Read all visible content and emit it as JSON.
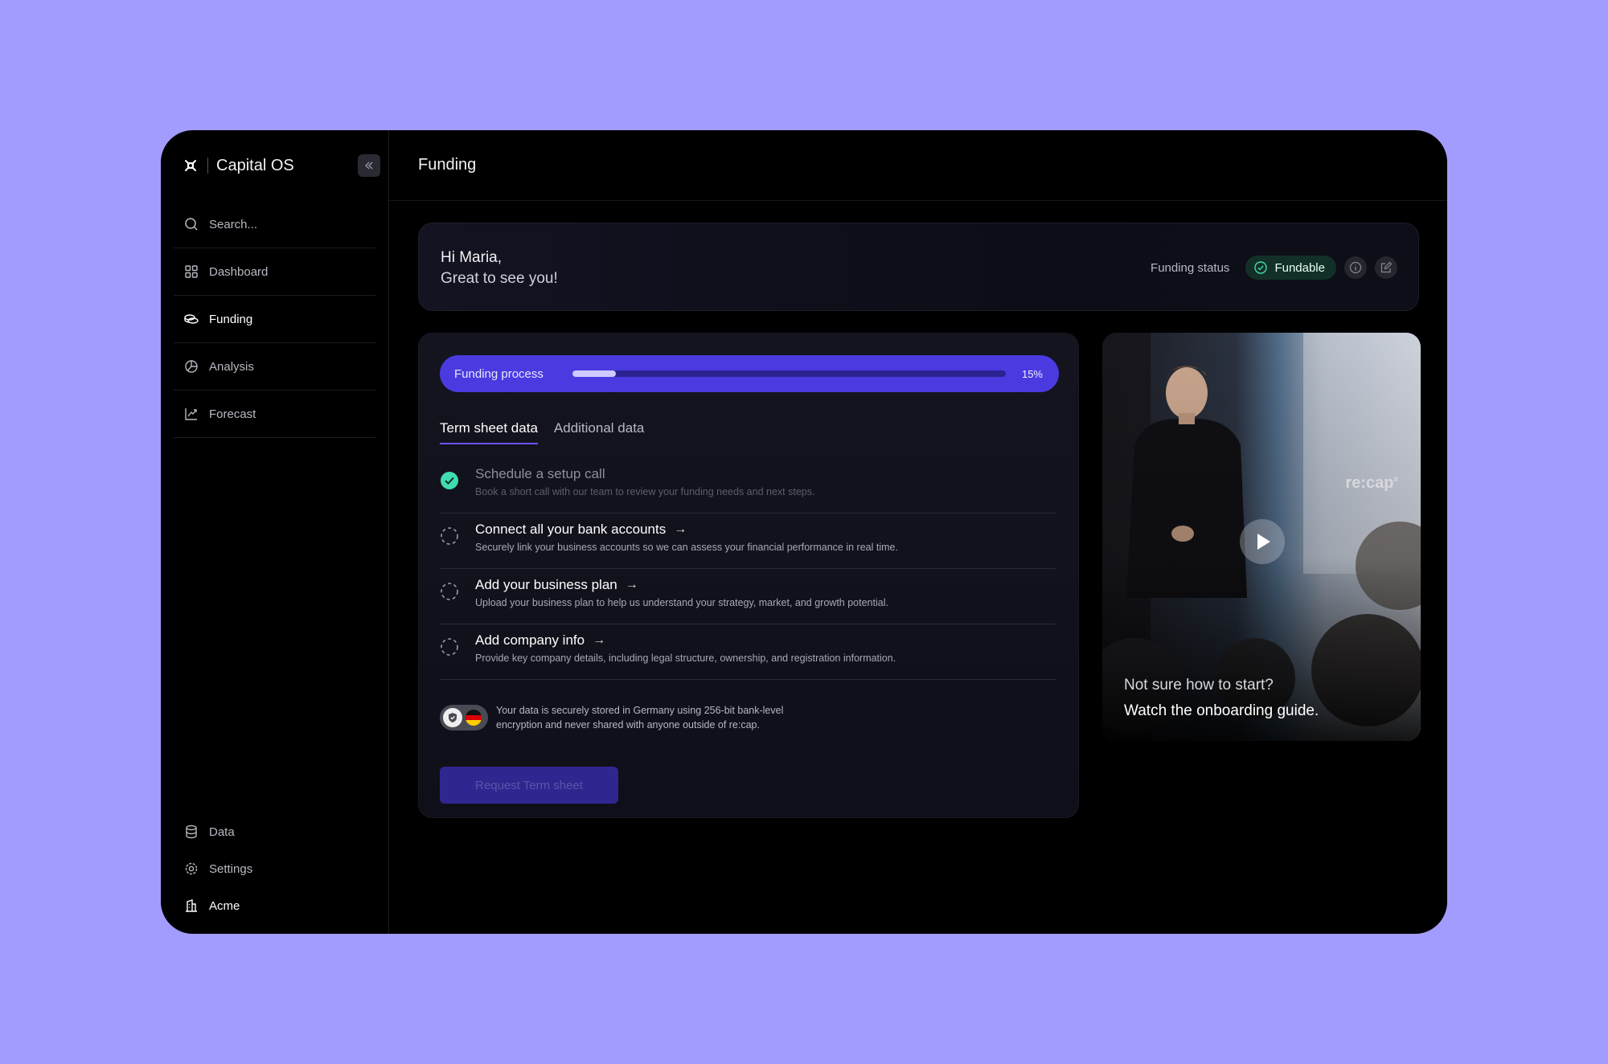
{
  "sidebar": {
    "brand": "Capital OS",
    "search_placeholder": "Search...",
    "items": [
      {
        "label": "Dashboard"
      },
      {
        "label": "Funding"
      },
      {
        "label": "Analysis"
      },
      {
        "label": "Forecast"
      }
    ],
    "bottom_items": [
      {
        "label": "Data"
      },
      {
        "label": "Settings"
      },
      {
        "label": "Acme"
      }
    ]
  },
  "header": {
    "title": "Funding"
  },
  "greeting": {
    "line1": "Hi Maria,",
    "line2": "Great to see you!",
    "status_label": "Funding status",
    "status_value": "Fundable"
  },
  "process": {
    "label": "Funding process",
    "percent_label": "15%",
    "progress": 0.1,
    "tabs": [
      {
        "label": "Term sheet data"
      },
      {
        "label": "Additional data"
      }
    ],
    "steps": [
      {
        "title": "Schedule a setup call",
        "desc": "Book a short call with our team to review your funding needs and next steps.",
        "done": true
      },
      {
        "title": "Connect all your bank accounts",
        "desc": "Securely link your business accounts so we can assess your financial performance in real time.",
        "done": false
      },
      {
        "title": "Add your business plan",
        "desc": "Upload your business plan to help us understand your strategy, market, and growth potential.",
        "done": false
      },
      {
        "title": "Add company info",
        "desc": "Provide key company details, including legal structure, ownership, and registration information.",
        "done": false
      }
    ],
    "security_line1": "Your data is securely stored in Germany using 256-bit bank-level",
    "security_line2": "encryption and never shared with anyone outside of re:cap.",
    "button_label": "Request Term sheet"
  },
  "video": {
    "logo": "re:cap",
    "logo_mark": "¤",
    "line1": "Not sure how to start?",
    "line2": "Watch the onboarding guide."
  },
  "colors": {
    "page_bg": "#a39cff",
    "accent": "#4a3be0",
    "success": "#3fdcb0"
  }
}
